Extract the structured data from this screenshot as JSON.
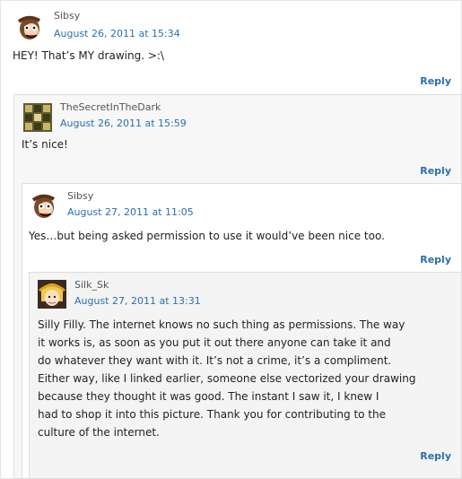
{
  "comments": [
    {
      "author": "Sibsy",
      "date": "August 26, 2011 at 15:34",
      "text": "HEY! That’s MY drawing. >:\\",
      "reply": "Reply",
      "avatar": "cartoon-monkey-avatar"
    },
    {
      "author": "TheSecretInTheDark",
      "date": "August 26, 2011 at 15:59",
      "text": "It’s nice!",
      "reply": "Reply",
      "avatar": "pattern-avatar"
    },
    {
      "author": "Sibsy",
      "date": "August 27, 2011 at 11:05",
      "text": "Yes…but being asked permission to use it would’ve been nice too.",
      "reply": "Reply",
      "avatar": "cartoon-monkey-avatar"
    },
    {
      "author": "Silk_Sk",
      "date": "August 27, 2011 at 13:31",
      "lines": [
        "Silly Filly. The internet knows no such thing as permissions. The way",
        "it works is, as soon as you put it out there anyone can take it and",
        "do whatever they want with it. It’s not a crime, it’s a compliment.",
        "Either way, like I linked earlier, someone else vectorized your drawing",
        "because they thought it was good. The instant I saw it, I knew I",
        "had to shop it into this picture. Thank you for contributing to the",
        "culture of the internet."
      ],
      "reply": "Reply",
      "avatar": "anime-character-avatar"
    }
  ],
  "colors": {
    "link": "#2a6fb1",
    "text": "#222222",
    "border": "#dddddd"
  }
}
